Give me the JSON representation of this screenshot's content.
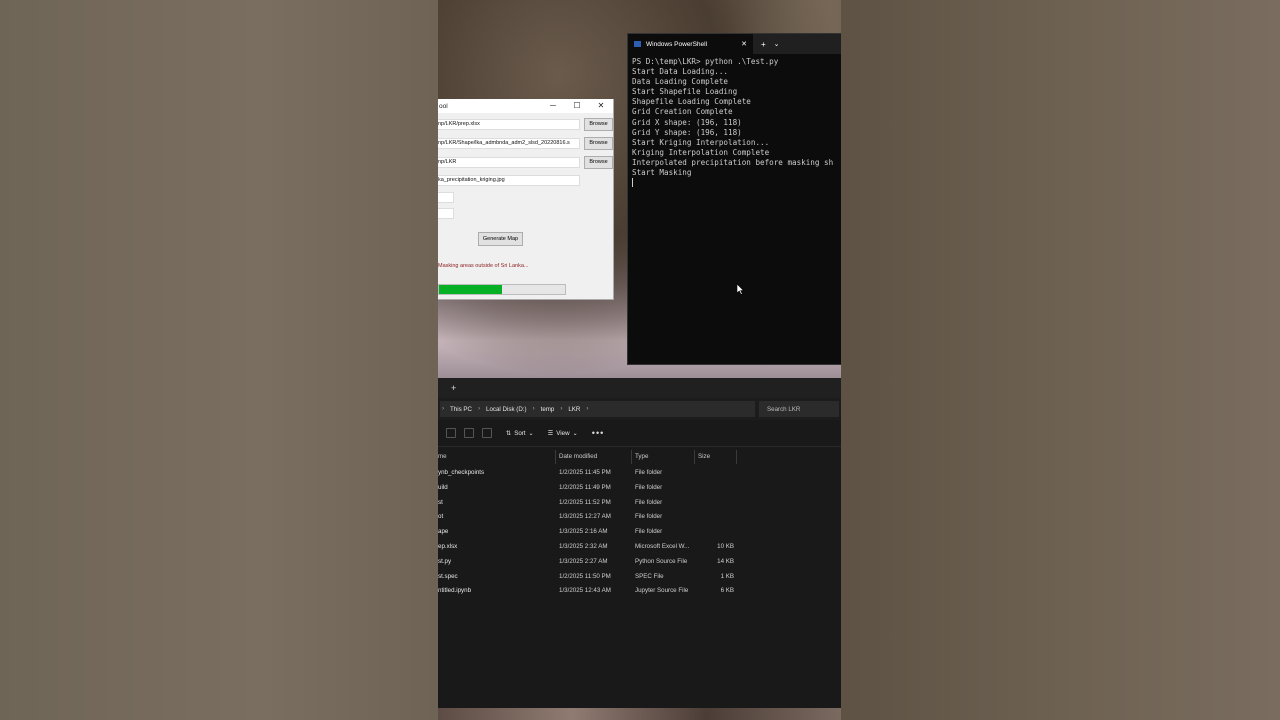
{
  "tool": {
    "title": "ool",
    "controls": [
      "─",
      "☐",
      "✕"
    ],
    "fields": [
      {
        "value": "np/LKR/prep.xlsx",
        "browse": "Browse"
      },
      {
        "value": "np/LKR/Shape/lka_admbnda_adm2_slsd_20220816.s",
        "browse": "Browse"
      },
      {
        "value": "np/LKR",
        "browse": "Browse"
      },
      {
        "value": "ka_precipitation_kriging.jpg",
        "browse": ""
      }
    ],
    "generate_label": "Generate Map",
    "status": "Masking areas outside of Sri Lanka...",
    "progress_fraction": 0.5
  },
  "powershell": {
    "tab_title": "Windows PowerShell",
    "close": "✕",
    "plus": "+",
    "chevron": "⌄",
    "lines": [
      "PS D:\\temp\\LKR> python .\\Test.py",
      "Start Data Loading...",
      "Data Loading Complete",
      "Start Shapefile Loading",
      "Shapefile Loading Complete",
      "Grid Creation Complete",
      "Grid X shape: (196, 118)",
      "Grid Y shape: (196, 118)",
      "Start Kriging Interpolation...",
      "Kriging Interpolation Complete",
      "Interpolated precipitation before masking sh",
      "Start Masking"
    ]
  },
  "explorer": {
    "new_tab": "+",
    "breadcrumb": [
      "This PC",
      "Local Disk (D:)",
      "temp",
      "LKR"
    ],
    "search_placeholder": "Search LKR",
    "sort_label": "Sort",
    "view_label": "View",
    "more": "•••",
    "columns": {
      "name": "me",
      "date": "Date modified",
      "type": "Type",
      "size": "Size"
    },
    "rows": [
      {
        "name": "ynb_checkpoints",
        "date": "1/2/2025 11:45 PM",
        "type": "File folder",
        "size": ""
      },
      {
        "name": "uild",
        "date": "1/2/2025 11:49 PM",
        "type": "File folder",
        "size": ""
      },
      {
        "name": "st",
        "date": "1/2/2025 11:52 PM",
        "type": "File folder",
        "size": ""
      },
      {
        "name": "ot",
        "date": "1/3/2025 12:27 AM",
        "type": "File folder",
        "size": ""
      },
      {
        "name": "ape",
        "date": "1/3/2025 2:16 AM",
        "type": "File folder",
        "size": ""
      },
      {
        "name": "ep.xlsx",
        "date": "1/3/2025 2:32 AM",
        "type": "Microsoft Excel W...",
        "size": "10 KB"
      },
      {
        "name": "st.py",
        "date": "1/3/2025 2:27 AM",
        "type": "Python Source File",
        "size": "14 KB"
      },
      {
        "name": "st.spec",
        "date": "1/2/2025 11:50 PM",
        "type": "SPEC File",
        "size": "1 KB"
      },
      {
        "name": "ntitled.ipynb",
        "date": "1/3/2025 12:43 AM",
        "type": "Jupyter Source File",
        "size": "6 KB"
      }
    ]
  }
}
